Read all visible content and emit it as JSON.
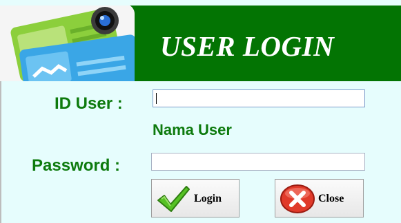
{
  "header": {
    "title": "USER LOGIN"
  },
  "form": {
    "id_user_label": "ID User :",
    "id_user_value": "",
    "nama_user_text": "Nama User",
    "password_label": "Password :",
    "password_value": ""
  },
  "buttons": {
    "login_label": "Login",
    "login_icon": "checkmark-icon",
    "close_label": "Close",
    "close_icon": "close-icon"
  },
  "colors": {
    "header_bg": "#037403",
    "label_green": "#0d7a0d",
    "form_bg": "#e6fdfd"
  }
}
